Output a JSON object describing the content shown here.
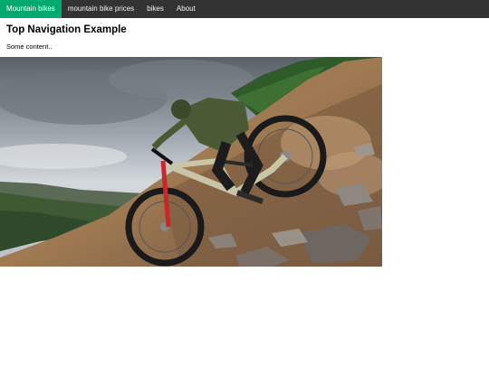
{
  "nav": {
    "items": [
      {
        "label": "Mountain bikes",
        "active": true
      },
      {
        "label": "mountain bike prices",
        "active": false
      },
      {
        "label": "bikes",
        "active": false
      },
      {
        "label": "About",
        "active": false
      }
    ]
  },
  "main": {
    "title": "Top Navigation Example",
    "body_text": "Some content.."
  },
  "colors": {
    "nav_bg": "#333333",
    "nav_active": "#04AA6D",
    "nav_text": "#f2f2f2"
  }
}
